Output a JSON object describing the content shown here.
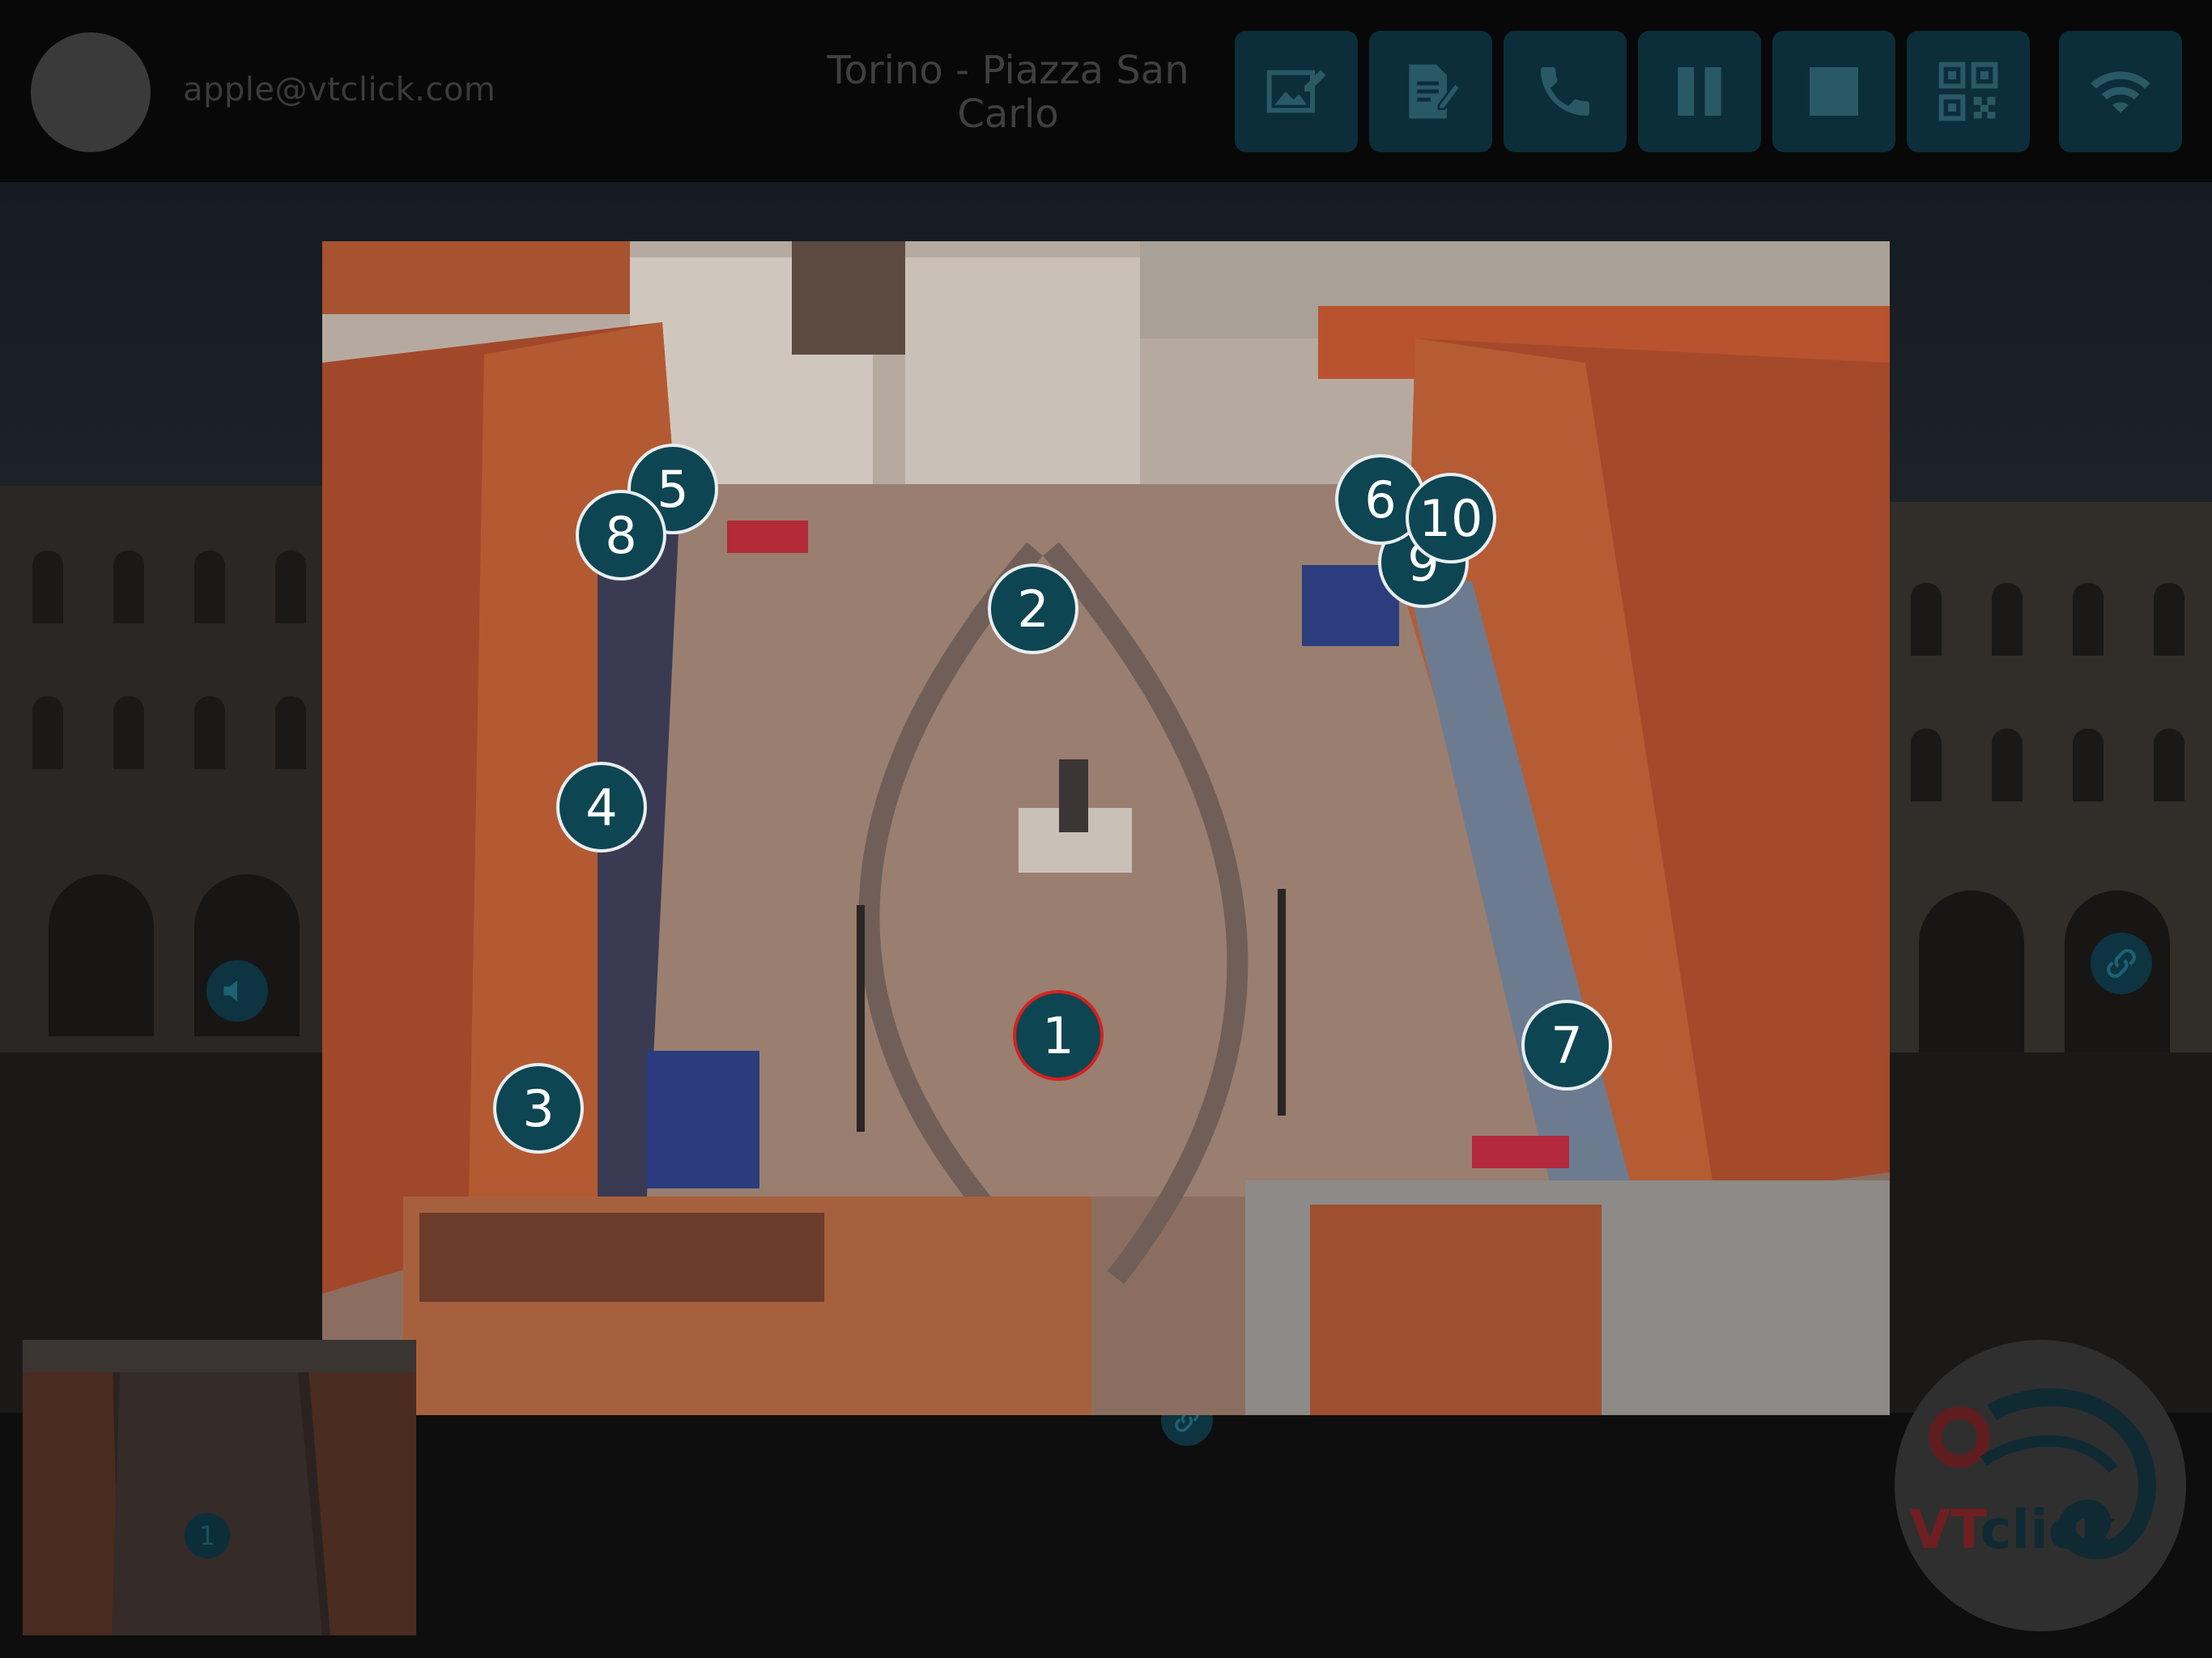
{
  "header": {
    "email": "apple@vtclick.com",
    "title": "Torino - Piazza San Carlo"
  },
  "toolbar": [
    {
      "name": "image-annotate-button",
      "icon": "image-edit-icon"
    },
    {
      "name": "document-edit-button",
      "icon": "document-edit-icon"
    },
    {
      "name": "call-button",
      "icon": "phone-icon"
    },
    {
      "name": "pause-button",
      "icon": "pause-icon"
    },
    {
      "name": "stop-button",
      "icon": "stop-icon"
    },
    {
      "name": "qr-code-button",
      "icon": "qr-code-icon"
    },
    {
      "name": "wifi-button",
      "icon": "wifi-icon"
    }
  ],
  "map": {
    "markers": [
      {
        "label": "1",
        "active": true
      },
      {
        "label": "2",
        "active": false
      },
      {
        "label": "3",
        "active": false
      },
      {
        "label": "4",
        "active": false
      },
      {
        "label": "5",
        "active": false
      },
      {
        "label": "6",
        "active": false
      },
      {
        "label": "7",
        "active": false
      },
      {
        "label": "8",
        "active": false
      },
      {
        "label": "9",
        "active": false
      },
      {
        "label": "10",
        "active": false
      }
    ]
  },
  "minimap": {
    "marker_label": "1"
  },
  "logo": {
    "vt": "VT",
    "click": "click"
  },
  "colors": {
    "marker_fill": "#0e4552",
    "marker_active_ring": "#d4221f",
    "toolbar_button": "#0b2e3a"
  }
}
